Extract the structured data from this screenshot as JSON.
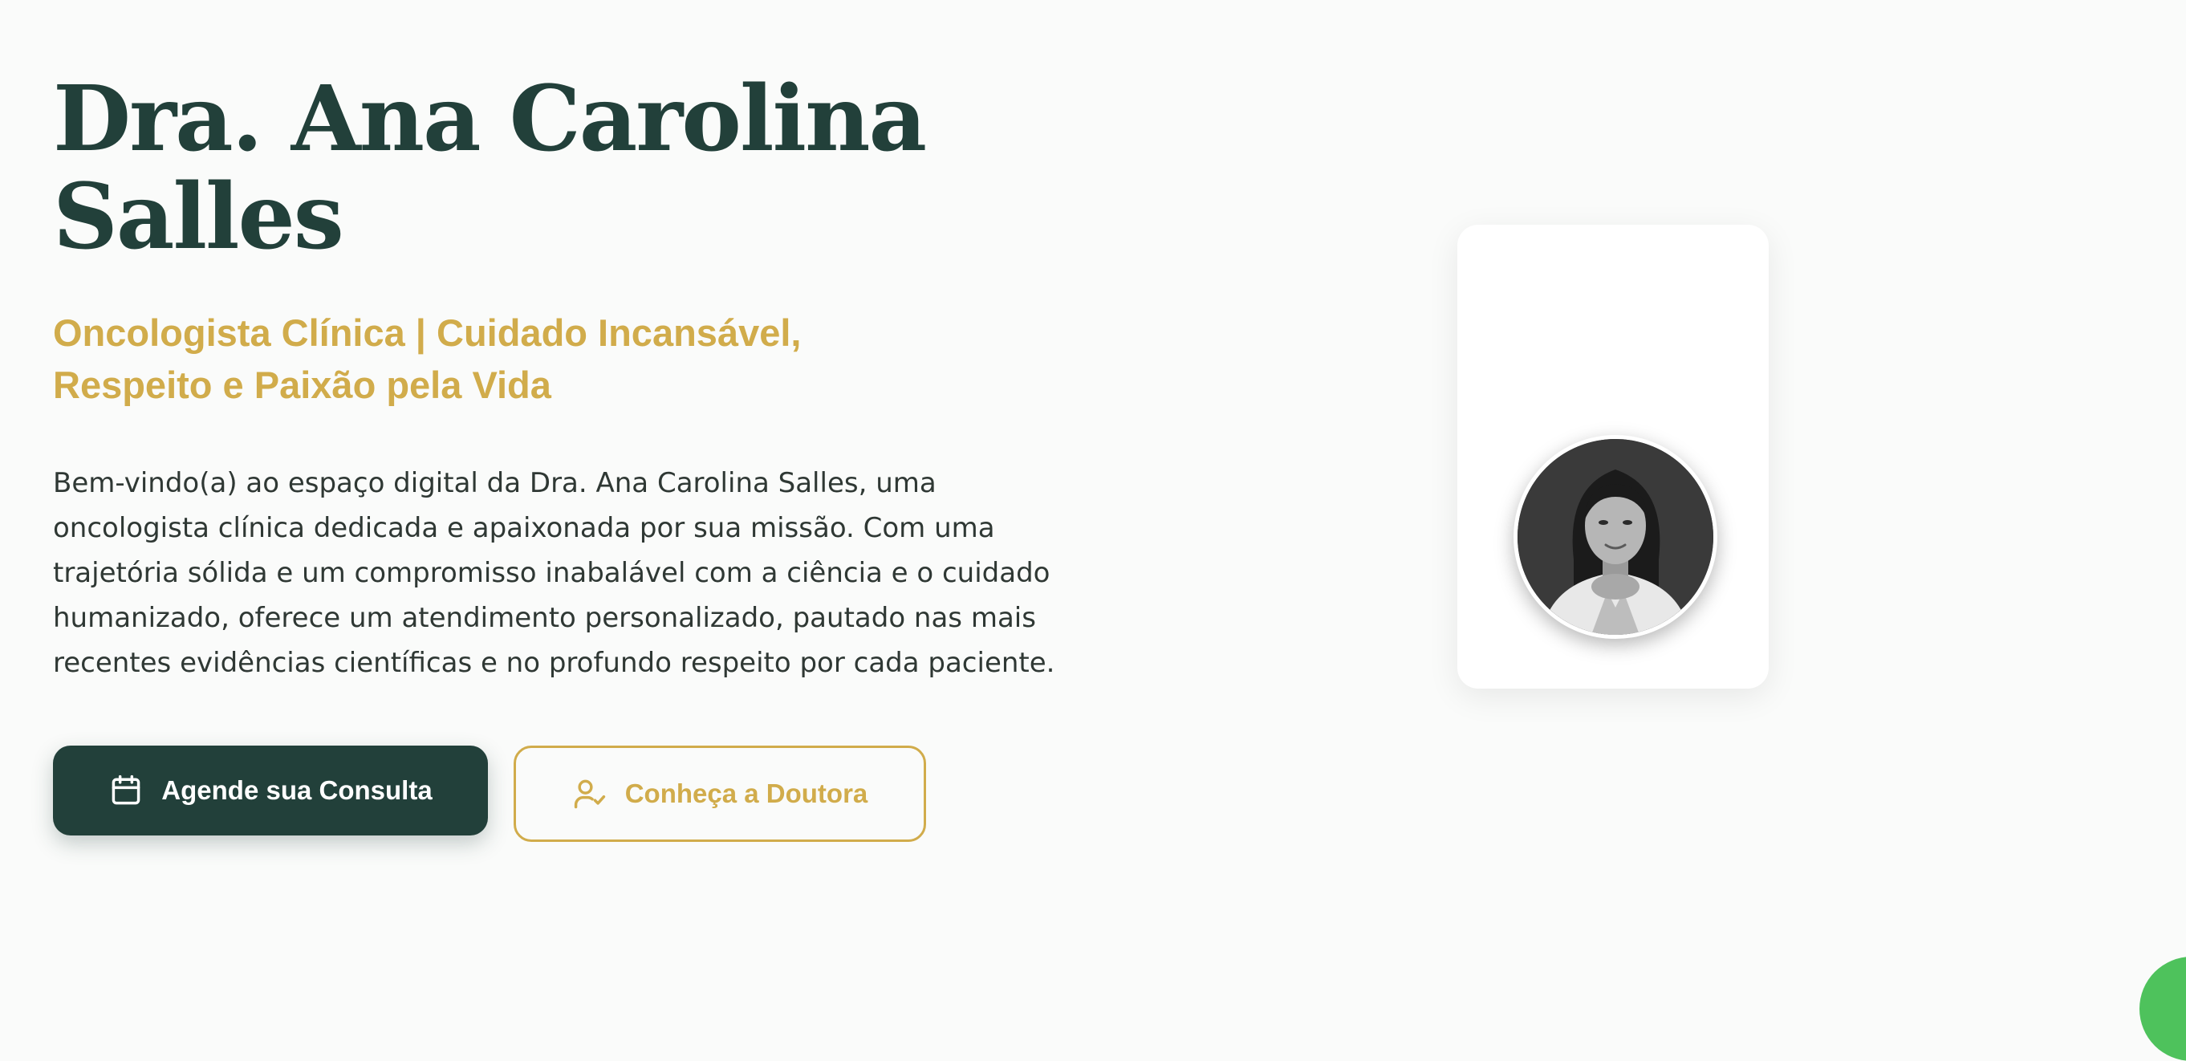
{
  "hero": {
    "title": "Dra. Ana Carolina Salles",
    "subtitle": "Oncologista Clínica | Cuidado Incansável, Respeito e Paixão pela Vida",
    "description": "Bem-vindo(a) ao espaço digital da Dra. Ana Carolina Salles, uma oncologista clínica dedicada e apaixonada por sua missão. Com uma trajetória sólida e um compromisso inabalável com a ciência e o cuidado humanizado, oferece um atendimento personalizado, pautado nas mais recentes evidências científicas e no profundo respeito por cada paciente."
  },
  "buttons": {
    "primary": {
      "label": "Agende sua Consulta",
      "icon": "calendar-icon"
    },
    "secondary": {
      "label": "Conheça a Doutora",
      "icon": "user-check-icon"
    }
  },
  "portrait": {
    "image": "doctor-portrait"
  },
  "colors": {
    "primary": "#22403a",
    "accent": "#d1ac4b",
    "background": "#fafbfa",
    "chat": "#4ec25c"
  }
}
